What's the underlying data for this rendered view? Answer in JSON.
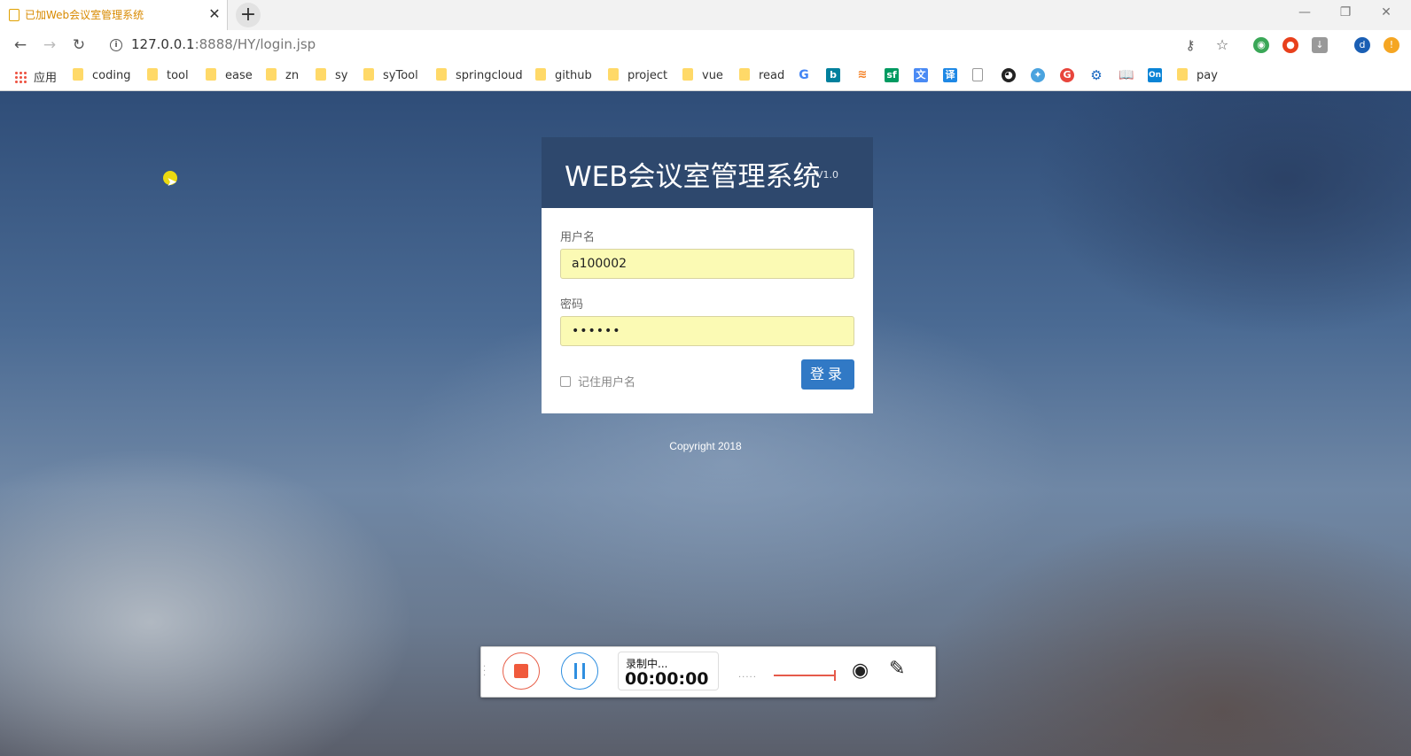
{
  "browser": {
    "tab": {
      "title": "已加Web会议室管理系统"
    },
    "address": {
      "host": "127.0.0.1",
      "path": ":8888/HY/login.jsp"
    },
    "bookmarks": {
      "apps_label": "应用",
      "folders": [
        "coding",
        "tool",
        "ease",
        "zn",
        "sy",
        "syTool",
        "springcloud",
        "github",
        "project",
        "vue",
        "read"
      ],
      "last_folder": "pay"
    }
  },
  "login": {
    "title": "WEB会议室管理系统",
    "version": "V1.0",
    "username_label": "用户名",
    "username_value": "a100002",
    "password_label": "密码",
    "password_value": "••••••",
    "remember_label": "记住用户名",
    "submit_label": "登录"
  },
  "footer": {
    "copyright": "Copyright 2018"
  },
  "recorder": {
    "status_label": "录制中...",
    "elapsed": "00:00:00",
    "level_dots": "....."
  },
  "colors": {
    "header_bg": "#2e486d",
    "button_blue": "#3179c5",
    "input_autofill": "#fbfab4",
    "record_red": "#f05a3c",
    "pause_blue": "#2f8fe0"
  }
}
